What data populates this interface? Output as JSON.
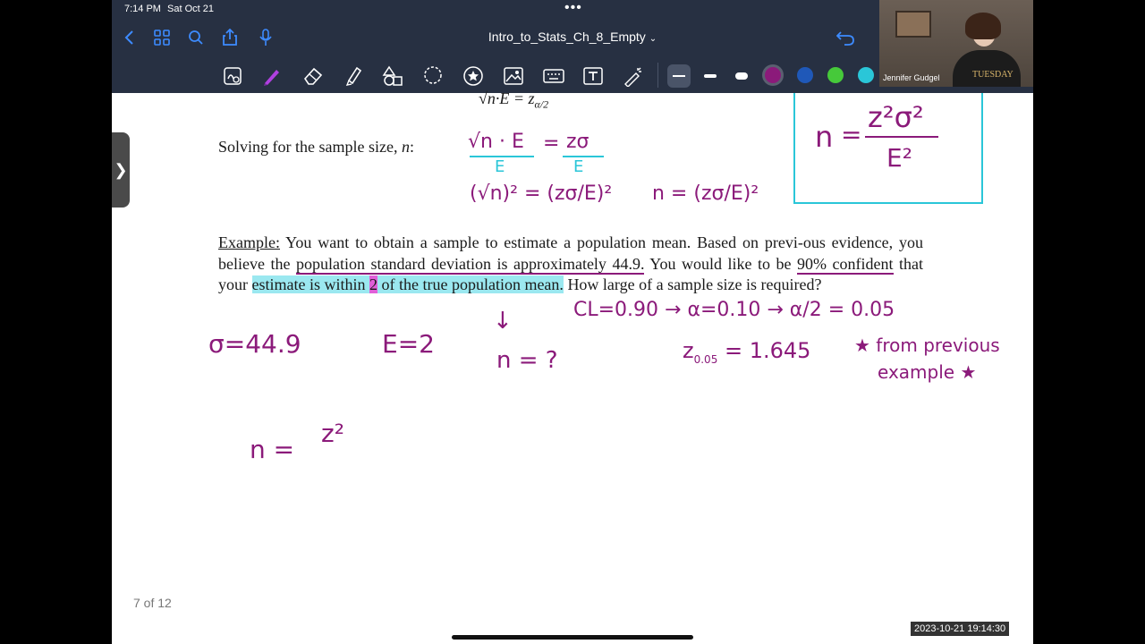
{
  "status": {
    "time": "7:14 PM",
    "date": "Sat Oct 21"
  },
  "nav": {
    "title": "Intro_to_Stats_Ch_8_Empty"
  },
  "toolbar": {
    "tools": [
      "text-recognition-icon",
      "pen-icon",
      "eraser-icon",
      "highlighter-icon",
      "shapes-icon",
      "lasso-icon",
      "sticker-icon",
      "image-icon",
      "keyboard-icon",
      "text-box-icon",
      "laser-pointer-icon"
    ],
    "colors": {
      "purple": "#8b1a7a",
      "blue": "#1f58b8",
      "green": "#46c93a",
      "cyan": "#2ac6d8"
    }
  },
  "page": {
    "top_partial": "√n·E = z",
    "top_partial_sub": "α/2",
    "solving_line": "Solving for the sample size,",
    "solving_var": "n",
    "example_label": "Example:",
    "example_body_1": " You want to obtain a sample to estimate a population mean. Based on previ-ous evidence, you believe the ",
    "example_highlight_1": "population standard deviation is approximately 44.9.",
    "example_body_2": " You would like to be ",
    "example_highlight_2": "90% confident",
    "example_body_3": " that your ",
    "example_highlight_3": "estimate is within ",
    "example_highlight_4": "2",
    "example_highlight_5": " of the true population mean.",
    "example_body_4": " How large of a sample size is required?",
    "page_counter": "7 of 12"
  },
  "handwriting": {
    "box_n": "n",
    "box_eq": "=",
    "box_num": "z²σ²",
    "box_den": "E²",
    "step1_left": "√n · E",
    "step1_eq": "=",
    "step1_right": "zσ",
    "step1_den_left": "E",
    "step1_den_right": "E",
    "step2": "(√n)² = (zσ/E)²",
    "step3": "n = (zσ/E)²",
    "cl_line": "CL=0.90 → α=0.10 → α/2 = 0.05",
    "sigma": "σ=44.9",
    "E": "E=2",
    "n_q": "n = ?",
    "z_val": "z",
    "z_sub": "0.05",
    "z_rest": " = 1.645",
    "note_1": "★ from previous",
    "note_2": "example ★",
    "n_eq": "n =",
    "n_z2": "z²"
  },
  "webcam": {
    "name": "Jennifer Gudgel",
    "shirt_text": "TUESDAY"
  },
  "timestamp": "2023-10-21  19:14:30"
}
